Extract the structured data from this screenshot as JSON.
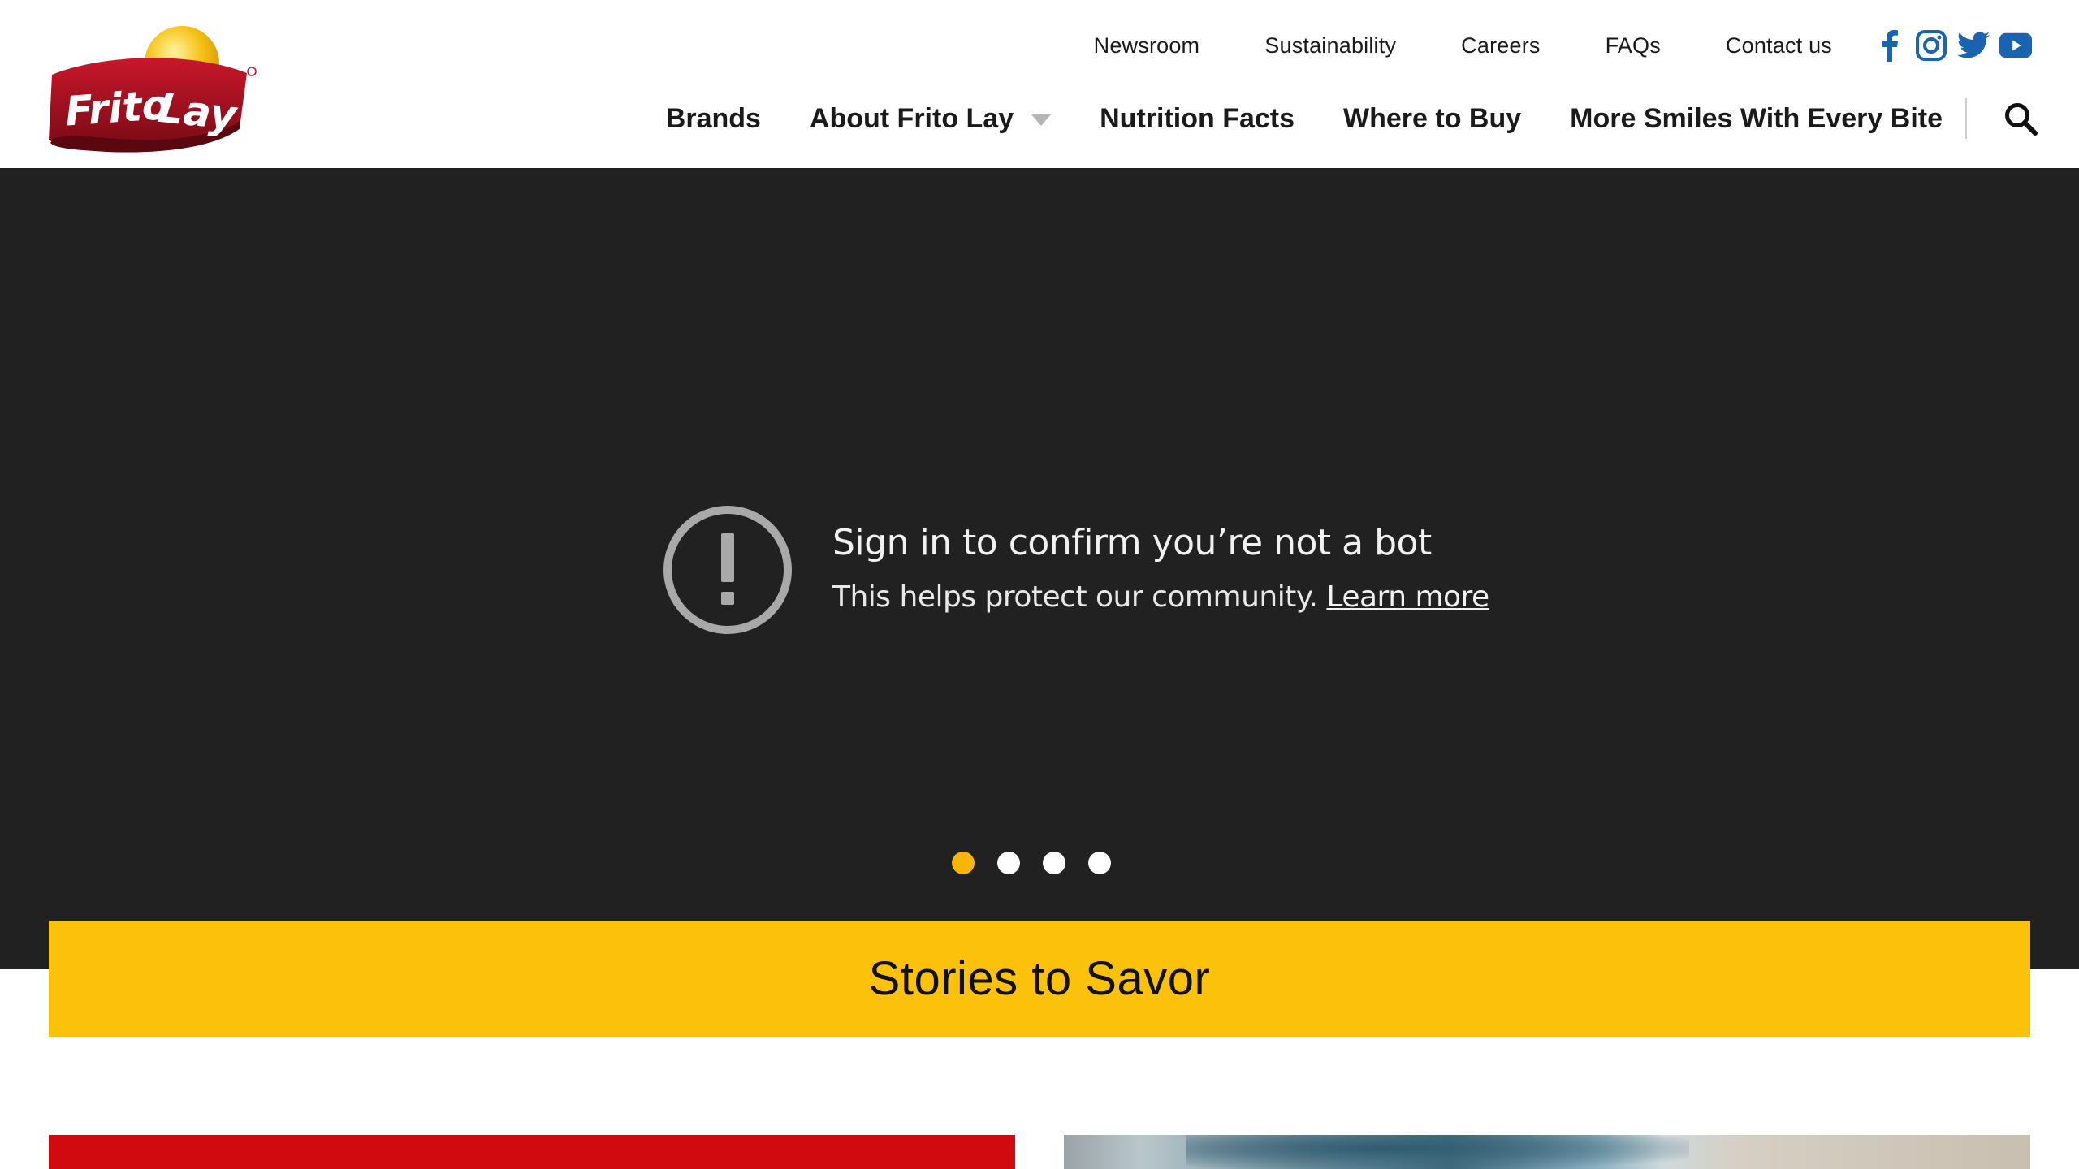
{
  "brand": {
    "logo_text": "FritoLay",
    "colors": {
      "logo_red": "#a4101e",
      "logo_sun": "#f6c319",
      "accent_yellow": "#fbc10b",
      "social_blue": "#1a63b0",
      "card_red": "#d10a10"
    }
  },
  "utility_nav": {
    "links": [
      "Newsroom",
      "Sustainability",
      "Careers",
      "FAQs",
      "Contact us"
    ],
    "social_icons": [
      "facebook-icon",
      "instagram-icon",
      "twitter-icon",
      "youtube-icon"
    ]
  },
  "main_nav": {
    "items": [
      "Brands",
      "About Frito Lay",
      "Nutrition Facts",
      "Where to Buy",
      "More Smiles With Every Bite"
    ],
    "dropdown_icon": "chevron-down-icon",
    "search_icon": "search-icon"
  },
  "hero": {
    "bot_title": "Sign in to confirm you’re not a bot",
    "bot_subtitle": "This helps protect our community.",
    "learn_more": "Learn more",
    "alert_icon": "alert-icon",
    "carousel": {
      "slide_count": 4,
      "active_index": 0
    }
  },
  "stories": {
    "title": "Stories to Savor"
  }
}
